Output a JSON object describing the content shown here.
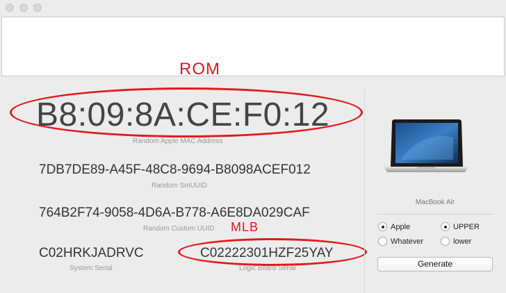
{
  "annotations": {
    "rom_label": "ROM",
    "mlb_label": "MLB"
  },
  "fields": {
    "mac_address": {
      "value": "B8:09:8A:CE:F0:12",
      "caption": "Random Apple MAC Address"
    },
    "smuuid": {
      "value": "7DB7DE89-A45F-48C8-9694-B8098ACEF012",
      "caption": "Random SmUUID"
    },
    "custom_uuid": {
      "value": "764B2F74-9058-4D6A-B778-A6E8DA029CAF",
      "caption": "Random Custom UUID"
    },
    "system_serial": {
      "value": "C02HRKJADRVC",
      "caption": "System Serial"
    },
    "logic_board_serial": {
      "value": "C02222301HZF25YAY",
      "caption": "Logic Board Serial"
    }
  },
  "sidebar": {
    "model_label": "MacBook Air",
    "radios": {
      "apple": {
        "label": "Apple",
        "checked": true
      },
      "whatever": {
        "label": "Whatever",
        "checked": false
      },
      "upper": {
        "label": "UPPER",
        "checked": true
      },
      "lower": {
        "label": "lower",
        "checked": false
      }
    },
    "generate_label": "Generate"
  },
  "colors": {
    "annotation": "#e0191b",
    "background": "#ececec"
  }
}
